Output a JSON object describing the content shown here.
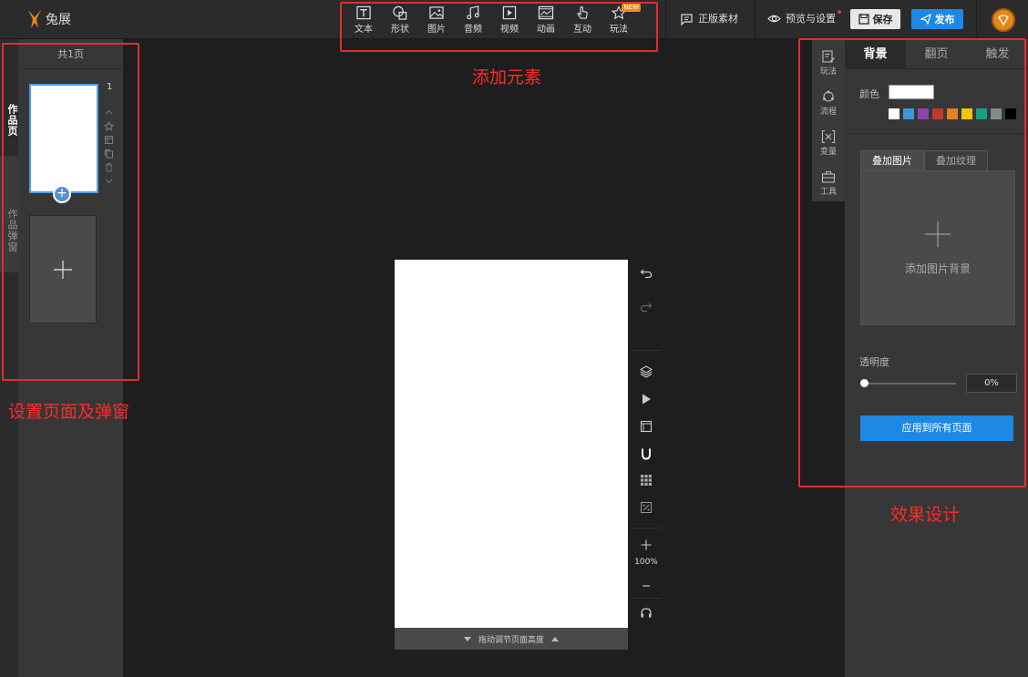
{
  "app": {
    "logo_text": "兔展"
  },
  "toolbar": {
    "items": [
      {
        "label": "文本",
        "icon": "text-icon"
      },
      {
        "label": "形状",
        "icon": "shape-icon"
      },
      {
        "label": "图片",
        "icon": "image-icon"
      },
      {
        "label": "音频",
        "icon": "audio-icon"
      },
      {
        "label": "视频",
        "icon": "video-icon"
      },
      {
        "label": "动画",
        "icon": "animation-icon"
      },
      {
        "label": "互动",
        "icon": "interaction-icon"
      },
      {
        "label": "玩法",
        "icon": "gameplay-icon"
      }
    ],
    "new_badge": "NEW"
  },
  "header": {
    "licensed_assets": "正版素材",
    "preview_settings": "预览与设置",
    "save": "保存",
    "publish": "发布"
  },
  "left_tabs": {
    "pages": "作品页",
    "popups": "作品弹窗"
  },
  "pages_panel": {
    "header": "共1页",
    "page_number": "1",
    "add_symbol": "+"
  },
  "canvas": {
    "footer_label": "拖动调节页面高度",
    "zoom": "100%"
  },
  "right_icons": [
    {
      "label": "玩法",
      "icon": "gameplay-edit-icon"
    },
    {
      "label": "流程",
      "icon": "flow-icon"
    },
    {
      "label": "变量",
      "icon": "variable-icon"
    },
    {
      "label": "工具",
      "icon": "toolbox-icon"
    }
  ],
  "right_panel": {
    "tabs": [
      "背景",
      "翻页",
      "触发"
    ],
    "color_label": "颜色",
    "current_color": "#ffffff",
    "swatches": [
      "#ffffff",
      "#3a9ad9",
      "#8e44ad",
      "#c0392b",
      "#e67e22",
      "#f1c40f",
      "#16a085",
      "#7f8c8d",
      "#000000"
    ],
    "subtabs": [
      "叠加图片",
      "叠加纹理"
    ],
    "add_bg_label": "添加图片背景",
    "opacity_label": "透明度",
    "opacity_value": "0%",
    "opacity_fraction": 0,
    "apply_all": "应用到所有页面"
  },
  "annotations": {
    "add_elements": "添加元素",
    "pages_popups": "设置页面及弹窗",
    "effects": "效果设计"
  },
  "colors": {
    "accent": "#1e88e5",
    "annotation": "#e32c2c"
  }
}
